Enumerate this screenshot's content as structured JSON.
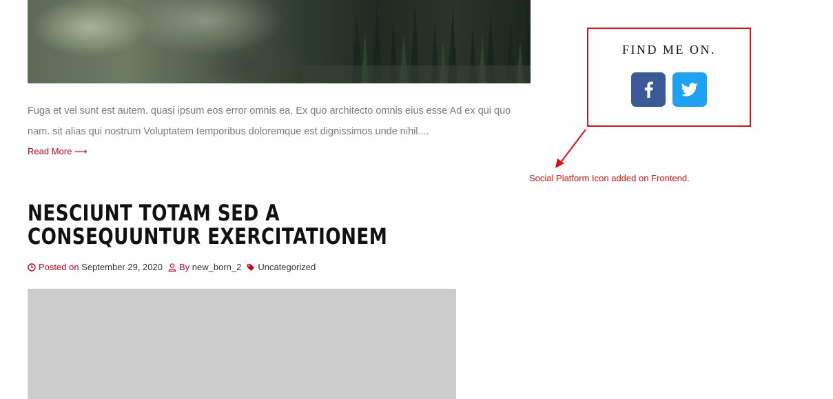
{
  "post_previous": {
    "excerpt": "Fuga et vel sunt est autem. quasi ipsum eos error omnis ea. Ex quo architecto omnis eius esse Ad ex qui quo nam. sit alias qui nostrum Voluptatem temporibus doloremque est dignissimos unde nihil....",
    "read_more": "Read More ⟶"
  },
  "post": {
    "title": "Nesciunt totam sed a consequuntur exercitationem",
    "posted_on_label": "Posted on",
    "date": "September 29, 2020",
    "by_label": "By",
    "author": "new_born_2",
    "category": "Uncategorized"
  },
  "sidebar": {
    "widget_title": "FIND ME ON.",
    "social": [
      {
        "name": "facebook",
        "icon": "facebook-icon",
        "color": "#3b5998"
      },
      {
        "name": "twitter",
        "icon": "twitter-icon",
        "color": "#1da1f2"
      }
    ]
  },
  "annotation": {
    "text": "Social Platform Icon added on Frontend.",
    "color": "#e01010"
  },
  "theme": {
    "accent": "#d0021b",
    "placeholder": "#cccccc"
  }
}
